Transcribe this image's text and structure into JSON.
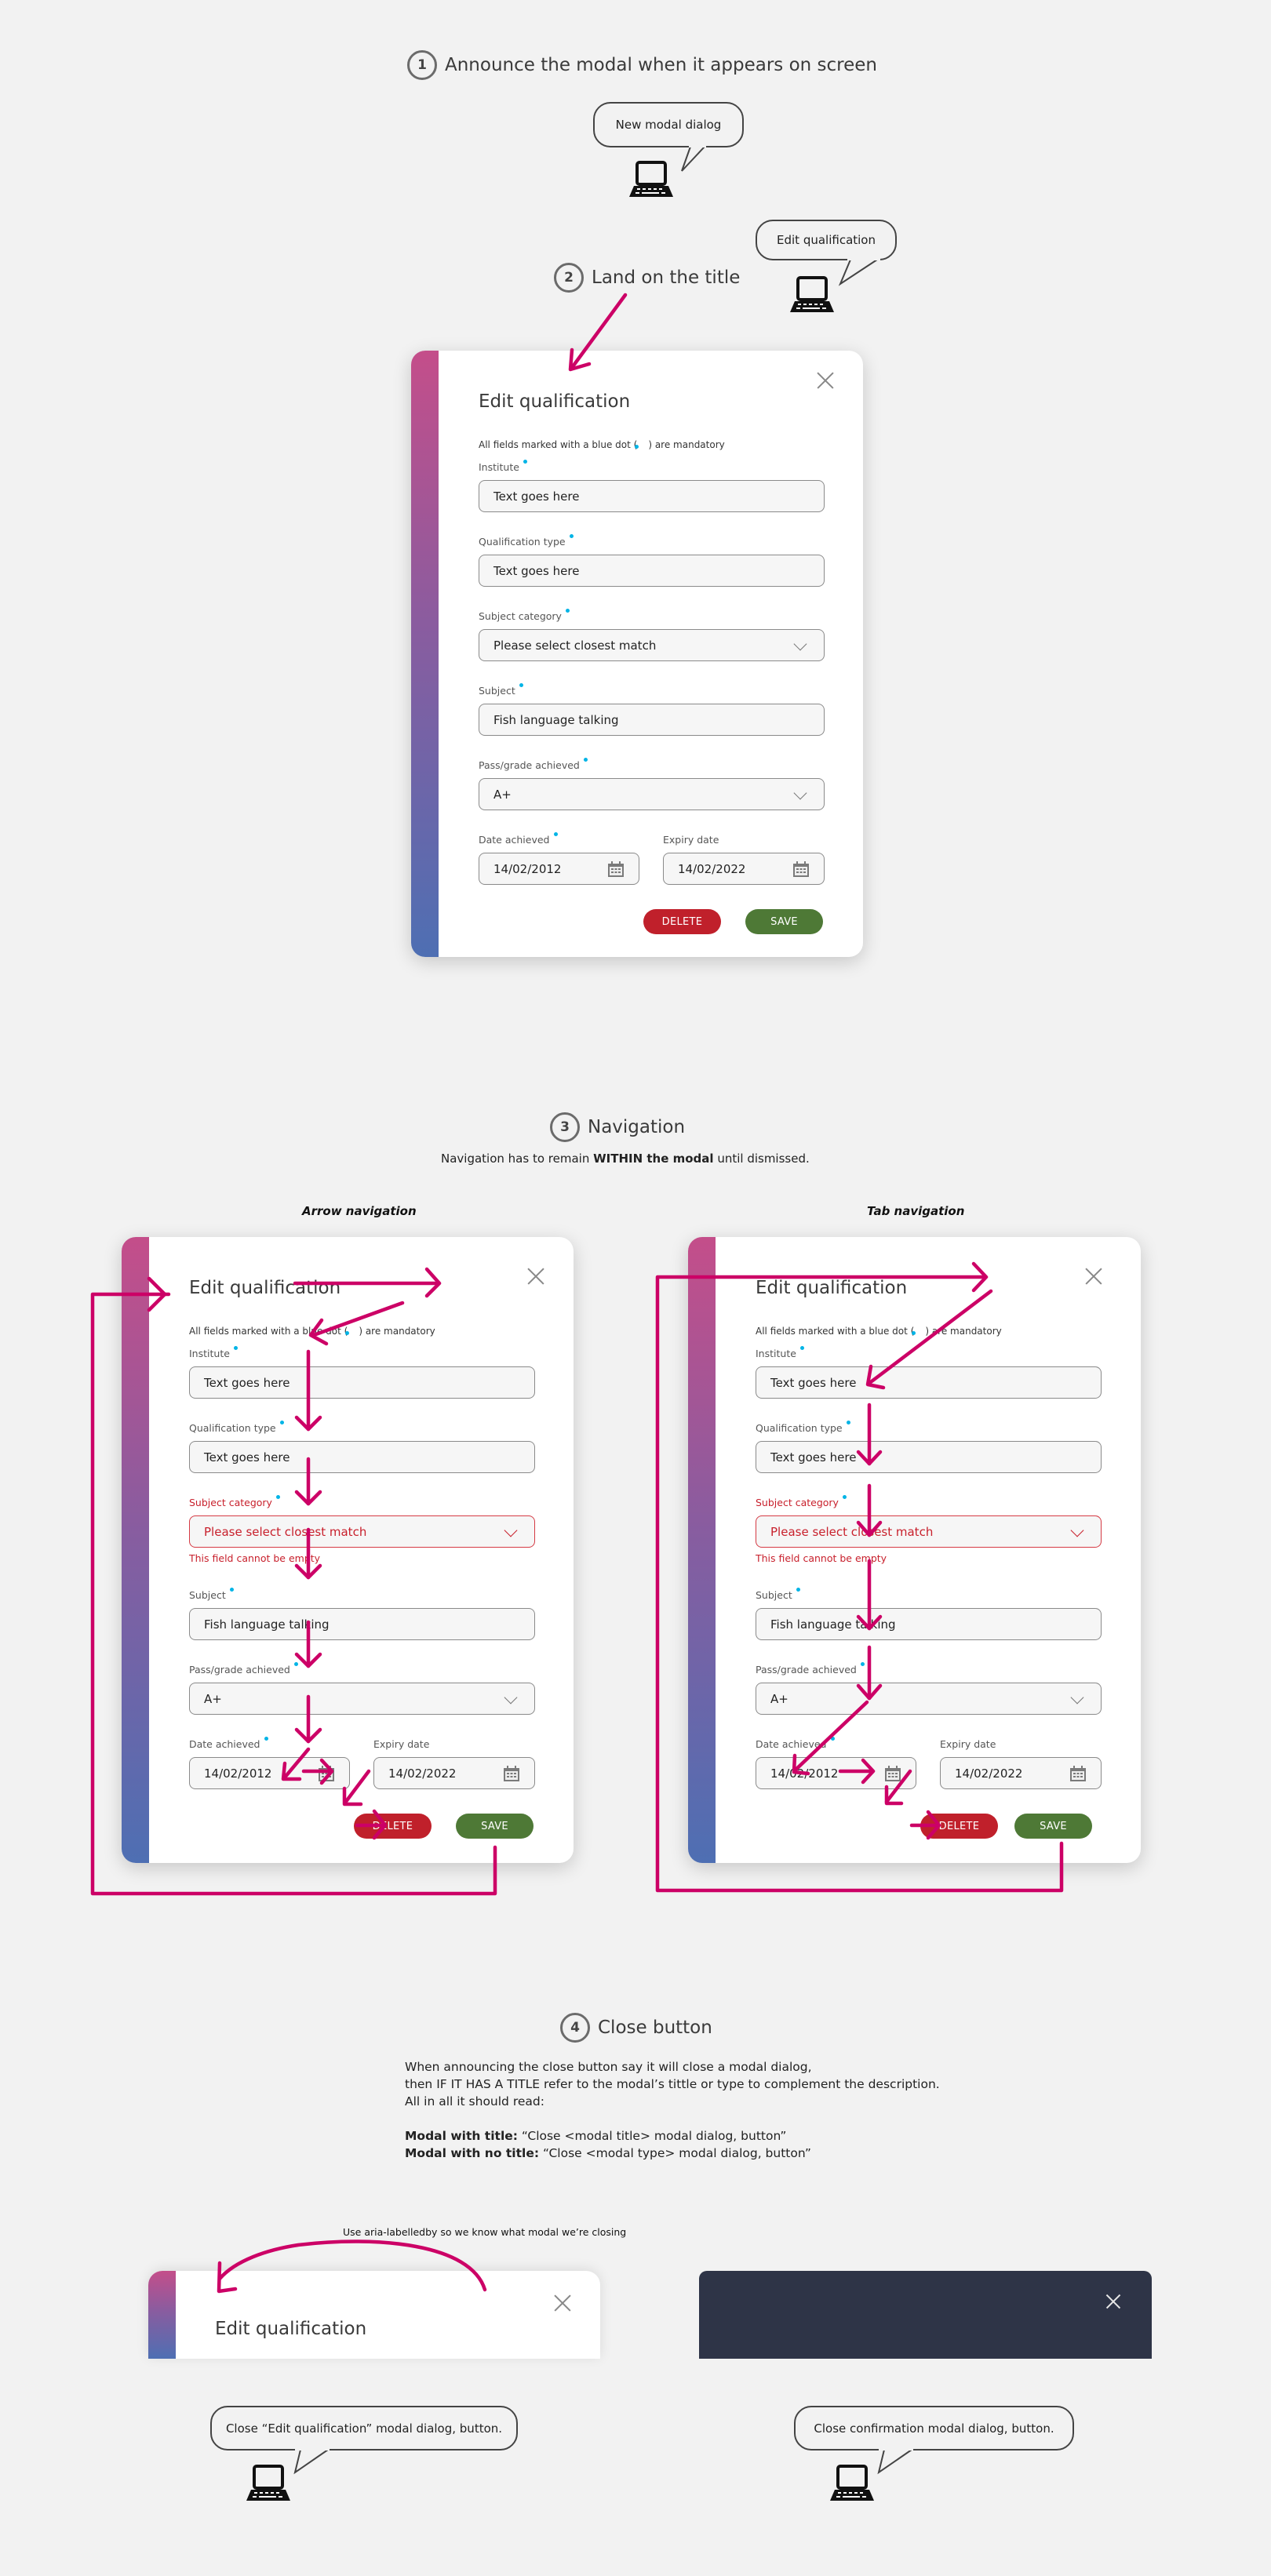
{
  "colors": {
    "background": "#f2f2f2",
    "accent_arrow": "#cc0066",
    "mandatory_dot": "#00b4e6",
    "error": "#c8202c",
    "delete_button": "#c0202b",
    "save_button": "#4e7936",
    "dark_modal": "#2e3447",
    "stripe_top": "#c44e8a",
    "stripe_bottom": "#4e6fb3"
  },
  "section1": {
    "number": "1",
    "title": "Announce the modal when it appears on screen",
    "bubble_text": "New modal dialog",
    "icon": "laptop-icon"
  },
  "section2": {
    "number": "2",
    "title": "Land on the title",
    "bubble_text": "Edit qualification",
    "icon": "laptop-icon"
  },
  "modal": {
    "title": "Edit qualification",
    "mandatory_note_before": "All fields marked with a blue dot (",
    "mandatory_note_after": ") are mandatory",
    "close_icon": "close-icon",
    "fields": {
      "institute": {
        "label": "Institute",
        "value": "Text goes here",
        "required": true
      },
      "qualification_type": {
        "label": "Qualification type",
        "value": "Text goes here",
        "required": true
      },
      "subject_category": {
        "label": "Subject category",
        "value": "Please select closest match",
        "required": true,
        "type": "select"
      },
      "subject": {
        "label": "Subject",
        "value": "Fish language talking",
        "required": true
      },
      "grade": {
        "label": "Pass/grade achieved",
        "value": "A+",
        "required": true,
        "type": "select"
      },
      "date_achieved": {
        "label": "Date achieved",
        "value": "14/02/2012",
        "required": true,
        "type": "date"
      },
      "expiry_date": {
        "label": "Expiry date",
        "value": "14/02/2022",
        "required": false,
        "type": "date"
      }
    },
    "error_message": "This field cannot be empty",
    "delete_label": "DELETE",
    "save_label": "SAVE"
  },
  "section3": {
    "number": "3",
    "title": "Navigation",
    "desc_before": "Navigation has to remain ",
    "desc_bold": "WITHIN the modal",
    "desc_after": " until dismissed.",
    "arrow_nav_label": "Arrow navigation",
    "tab_nav_label": "Tab navigation"
  },
  "section4": {
    "number": "4",
    "title": "Close button",
    "lines": [
      "When announcing the close button say it will close a modal dialog,",
      "then IF IT HAS A TITLE refer to the modal’s tittle or type to complement the description.",
      "All in all it should read:"
    ],
    "rule1_label": "Modal with title:",
    "rule1_text": " “Close <modal title> modal dialog, button”",
    "rule2_label": "Modal with no title:",
    "rule2_text": " “Close <modal type> modal dialog, button”",
    "aria_note": "Use aria-labelledby so we know what modal we’re closing",
    "bubble_titled": "Close “Edit qualification” modal dialog, button.",
    "bubble_untitled": "Close confirmation modal dialog, button."
  }
}
